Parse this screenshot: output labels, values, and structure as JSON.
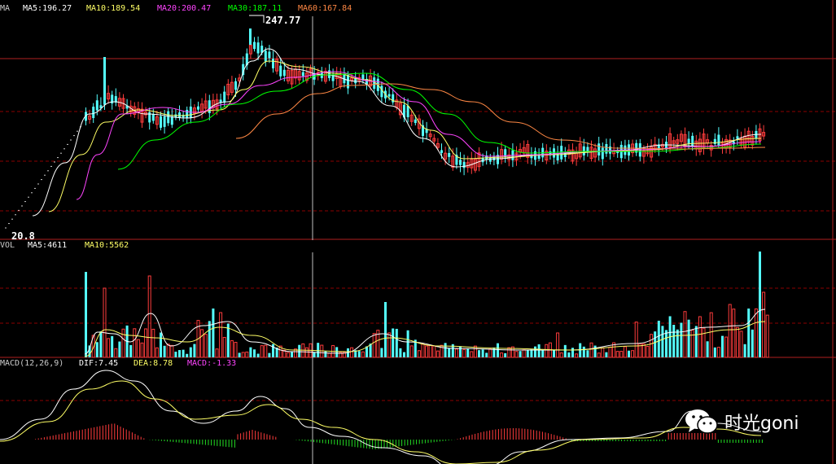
{
  "price_panel": {
    "indicator_name": "MA",
    "ma5_label": "MA5:196.27",
    "ma10_label": "MA10:189.54",
    "ma20_label": "MA20:200.47",
    "ma30_label": "MA30:187.11",
    "ma60_label": "MA60:167.84",
    "high_label": "247.77",
    "low_label": "20.8"
  },
  "volume_panel": {
    "indicator_name": "VOL",
    "ma5_label": "MA5:4611",
    "ma10_label": "MA10:5562"
  },
  "macd_panel": {
    "indicator_name": "MACD(12,26,9)",
    "dif_label": "DIF:7.45",
    "dea_label": "DEA:8.78",
    "macd_label": "MACD:-1.33"
  },
  "watermark": {
    "text": "时光goni",
    "icon": "wechat-icon"
  },
  "colors": {
    "background": "#000000",
    "grid": "#8b0000",
    "up": "#ff3c3c",
    "down": "#54ffff",
    "ma5": "#ffffff",
    "ma10": "#ffff66",
    "ma20": "#ff44ff",
    "ma30": "#00ff00",
    "ma60": "#ff8844",
    "crosshair": "#c0c0c0"
  }
}
